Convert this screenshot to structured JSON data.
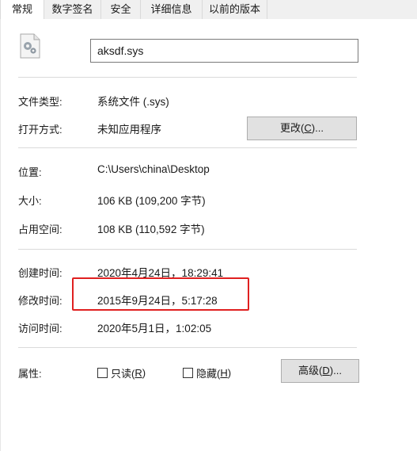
{
  "tabs": [
    {
      "label": "常规",
      "active": true
    },
    {
      "label": "数字签名",
      "active": false
    },
    {
      "label": "安全",
      "active": false
    },
    {
      "label": "详细信息",
      "active": false
    },
    {
      "label": "以前的版本",
      "active": false
    }
  ],
  "file": {
    "icon": "system-file-gear-icon",
    "name": "aksdf.sys"
  },
  "type_row": {
    "label": "文件类型:",
    "value": "系统文件 (.sys)"
  },
  "open_row": {
    "label": "打开方式:",
    "value": "未知应用程序",
    "button_text": "更改(",
    "button_key": "C",
    "button_suffix": ")..."
  },
  "location_row": {
    "label": "位置:",
    "value": "C:\\Users\\china\\Desktop"
  },
  "size_row": {
    "label": "大小:",
    "value": "106 KB (109,200 字节)"
  },
  "disk_row": {
    "label": "占用空间:",
    "value": "108 KB (110,592 字节)"
  },
  "created_row": {
    "label": "创建时间:",
    "value": "2020年4月24日，18:29:41"
  },
  "modified_row": {
    "label": "修改时间:",
    "value": "2015年9月24日，5:17:28"
  },
  "accessed_row": {
    "label": "访问时间:",
    "value": "2020年5月1日，1:02:05"
  },
  "attributes": {
    "label": "属性:",
    "readonly": {
      "text": "只读(",
      "key": "R",
      "suffix": ")",
      "checked": false
    },
    "hidden": {
      "text": "隐藏(",
      "key": "H",
      "suffix": ")",
      "checked": false
    },
    "advanced": {
      "text": "高级(",
      "key": "D",
      "suffix": ")..."
    }
  },
  "colors": {
    "highlight": "#e02020",
    "button_bg": "#e1e1e1",
    "separator": "#dadada"
  }
}
